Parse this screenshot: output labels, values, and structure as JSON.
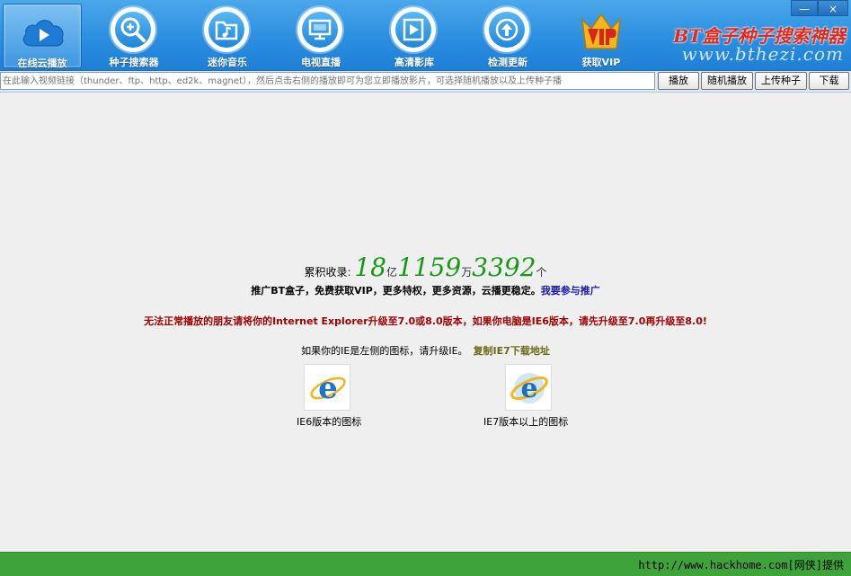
{
  "nav": {
    "items": [
      {
        "label": "在线云播放"
      },
      {
        "label": "种子搜索器"
      },
      {
        "label": "迷你音乐"
      },
      {
        "label": "电视直播"
      },
      {
        "label": "高清影库"
      },
      {
        "label": "检测更新"
      },
      {
        "label": "获取VIP"
      }
    ]
  },
  "brand": {
    "title": "BT盒子种子搜索神器",
    "url": "www.bthezi.com"
  },
  "window": {
    "minimize": "—",
    "close": "×"
  },
  "toolbar": {
    "input_placeholder": "在此输入视频链接（thunder、ftp、http、ed2k、magnet），然后点击右侧的播放即可为您立即播放影片，可选择随机播放以及上传种子播",
    "play_label": "播放",
    "random_label": "随机播放",
    "upload_label": "上传种子",
    "download_label": "下载"
  },
  "stats": {
    "prefix": "累积收录:",
    "n1": "18",
    "u1": "亿",
    "n2": "1159",
    "u2": "万",
    "n3": "3392",
    "u3": "个"
  },
  "promo": {
    "text": "推广BT盒子，免费获取VIP，更多特权，更多资源，云播更稳定。",
    "link": "我要参与推广"
  },
  "warning": "无法正常播放的朋友请将你的Internet Explorer升级至7.0或8.0版本，如果你电脑是IE6版本，请先升级至7.0再升级至8.0!",
  "ie_note": {
    "text": "如果你的IE是左侧的图标，请升级IE。",
    "link": "复制IE7下载地址"
  },
  "ie_icons": {
    "ie6_caption": "IE6版本的图标",
    "ie7_caption": "IE7版本以上的图标"
  },
  "footer": "http://www.hackhome.com[网侠]提供",
  "colors": {
    "header_blue": "#2b8fe0",
    "counter_green": "#169a16",
    "warning_red": "#a00000",
    "footer_green": "#3ea33a",
    "brand_red": "#e02a1e"
  }
}
